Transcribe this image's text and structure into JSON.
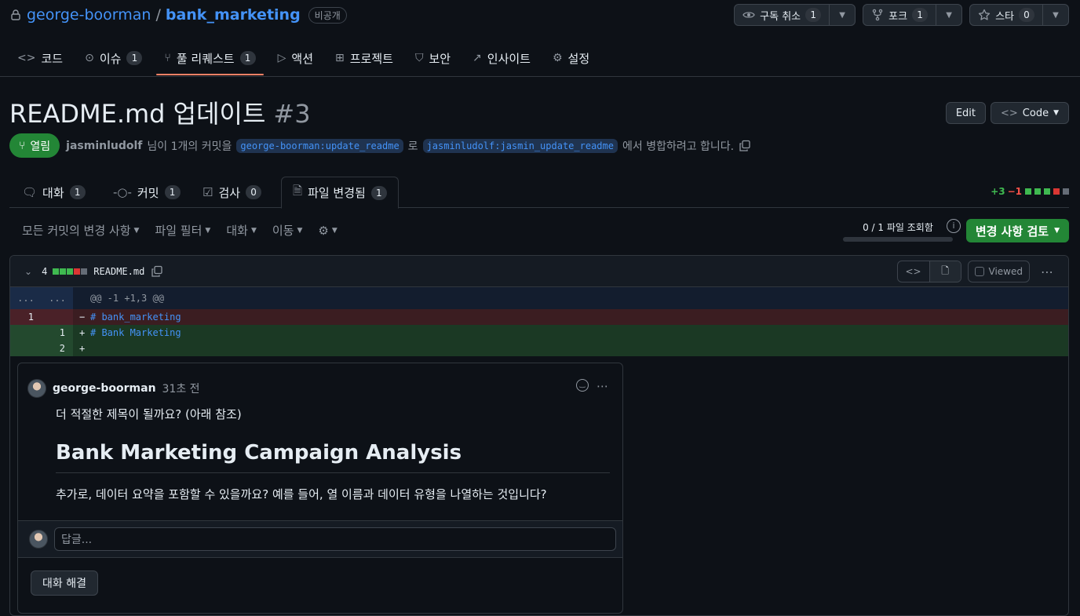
{
  "repo": {
    "owner": "george-boorman",
    "sep": "/",
    "name": "bank_marketing",
    "visibility": "비공개"
  },
  "header_buttons": [
    {
      "icon": "eye-icon",
      "label": "구독 취소",
      "count": "1"
    },
    {
      "icon": "fork-icon",
      "label": "포크",
      "count": "1"
    },
    {
      "icon": "star-icon",
      "label": "스타",
      "count": "0"
    }
  ],
  "repo_nav": [
    {
      "icon": "code-icon",
      "label": "코드",
      "count": ""
    },
    {
      "icon": "issue-icon",
      "label": "이슈",
      "count": "1"
    },
    {
      "icon": "pull-request-icon",
      "label": "풀 리퀘스트",
      "count": "1"
    },
    {
      "icon": "actions-icon",
      "label": "액션",
      "count": ""
    },
    {
      "icon": "project-icon",
      "label": "프로젝트",
      "count": ""
    },
    {
      "icon": "shield-icon",
      "label": "보안",
      "count": ""
    },
    {
      "icon": "graph-icon",
      "label": "인사이트",
      "count": ""
    },
    {
      "icon": "gear-icon",
      "label": "설정",
      "count": ""
    }
  ],
  "pr": {
    "title": "README.md 업데이트",
    "number": "#3",
    "edit_label": "Edit",
    "code_label": "Code",
    "state": "열림",
    "author": "jasminludolf",
    "meta_1": "님이 1개의 커밋을",
    "base_branch": "george-boorman:update_readme",
    "meta_2": "로",
    "head_branch": "jasminludolf:jasmin_update_readme",
    "meta_3": "에서 병합하려고 합니다."
  },
  "pr_tabs": [
    {
      "icon": "comment-icon",
      "label": "대화",
      "count": "1"
    },
    {
      "icon": "commit-icon",
      "label": "커밋",
      "count": "1"
    },
    {
      "icon": "checklist-icon",
      "label": "검사",
      "count": "0"
    },
    {
      "icon": "file-diff-icon",
      "label": "파일 변경됨",
      "count": "1"
    }
  ],
  "diffstat": {
    "additions": "+3",
    "deletions": "−1"
  },
  "toolbar": {
    "filters": [
      "모든 커밋의 변경 사항",
      "파일 필터",
      "대화",
      "이동"
    ],
    "viewed_progress": "0 / 1 파일 조회함",
    "review_button": "변경 사항 검토"
  },
  "file": {
    "changes": "4",
    "name": "README.md",
    "viewed_label": "Viewed",
    "hunk_old": "...",
    "hunk_new": "...",
    "hunk_header": "@@ -1 +1,3 @@",
    "lines": [
      {
        "type": "del",
        "old": "1",
        "new": "",
        "sign": "−",
        "text": "# bank_marketing"
      },
      {
        "type": "add",
        "old": "",
        "new": "1",
        "sign": "+",
        "text": "# Bank Marketing"
      },
      {
        "type": "add",
        "old": "",
        "new": "2",
        "sign": "+",
        "text": ""
      }
    ]
  },
  "comment": {
    "author": "george-boorman",
    "time": "31초 전",
    "line1": "더 적절한 제목이 될까요? (아래 참조)",
    "heading": "Bank Marketing Campaign Analysis",
    "line2": "추가로, 데이터 요약을 포함할 수 있을까요? 예를 들어, 열 이름과 데이터 유형을 나열하는 것입니다?",
    "reply_placeholder": "답글...",
    "resolve_label": "대화 해결"
  }
}
